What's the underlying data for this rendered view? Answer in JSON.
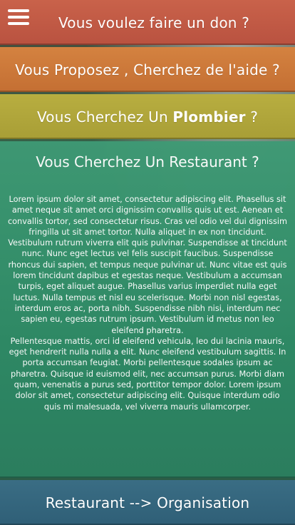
{
  "menu": {
    "icon": "hamburger-icon"
  },
  "panels": {
    "don": {
      "title": "Vous voulez faire un don ?"
    },
    "aide": {
      "title": "Vous Proposez , Cherchez de l'aide ?"
    },
    "plombier": {
      "prefix": "Vous Cherchez Un ",
      "bold": "Plombier",
      "suffix": " ?"
    },
    "restaurant": {
      "title": "Vous Cherchez Un Restaurant ?",
      "paragraph1": "Lorem ipsum dolor sit amet, consectetur adipiscing elit. Phasellus sit amet neque sit amet orci dignissim convallis quis ut est. Aenean et convallis tortor, sed consectetur risus. Cras vel odio vel dui dignissim fringilla ut sit amet tortor. Nulla aliquet in ex non tincidunt. Vestibulum rutrum viverra elit quis pulvinar. Suspendisse at tincidunt nunc. Nunc eget lectus vel felis suscipit faucibus. Suspendisse rhoncus dui sapien, et tempus neque pulvinar ut. Nunc vitae est quis lorem tincidunt dapibus et egestas neque. Vestibulum a accumsan turpis, eget aliquet augue. Phasellus varius imperdiet nulla eget luctus. Nulla tempus et nisl eu scelerisque. Morbi non nisl egestas, interdum eros ac, porta nibh. Suspendisse nibh nisi, interdum nec sapien eu, egestas rutrum ipsum. Vestibulum id metus non leo eleifend pharetra.",
      "paragraph2": "Pellentesque mattis, orci id eleifend vehicula, leo dui lacinia mauris, eget hendrerit nulla nulla a elit. Nunc eleifend vestibulum sagittis. In porta accumsan feugiat. Morbi pellentesque sodales ipsum ac pharetra. Quisque id euismod elit, nec accumsan purus. Morbi diam quam, venenatis a purus sed, porttitor tempor dolor. Lorem ipsum dolor sit amet, consectetur adipiscing elit. Quisque interdum odio quis mi malesuada, vel viverra mauris ullamcorper."
    },
    "organisation": {
      "title": "Restaurant --> Organisation"
    }
  }
}
